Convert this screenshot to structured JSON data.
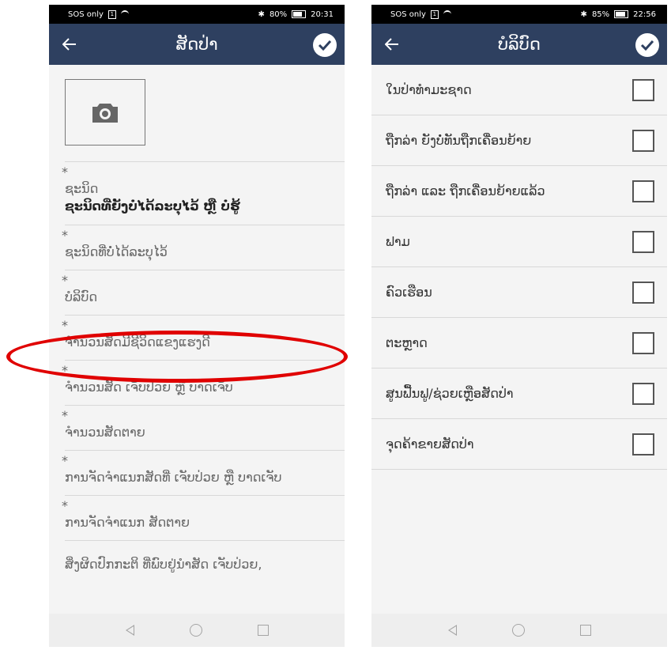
{
  "left": {
    "status": {
      "carrier": "SOS only",
      "battery": "80%",
      "time": "20:31"
    },
    "title": "ສັດປ່າ",
    "fields": [
      {
        "label": "ຊະນິດ",
        "value": "ຊະນິດທີ່ຍັງບໍ່ໄດ້ລະບຸໄວ້ ຫຼື ບໍ່ຮູ້",
        "required": "*"
      },
      {
        "label": "ຊະນິດທີ່ບໍ່ໄດ້ລະບຸໄວ້",
        "required": "*"
      },
      {
        "label": "ບໍລິບົດ",
        "required": "*"
      },
      {
        "label": "ຈຳນວນສັດມີຊີວິດແຂງແຮງດີ",
        "required": "*"
      },
      {
        "label": "ຈຳນວນສັດ ເຈັບປ່ວຍ ຫຼື ບາດເຈັບ",
        "required": "*"
      },
      {
        "label": "ຈຳນວນສັດຕາຍ",
        "required": "*"
      },
      {
        "label": "ການຈັດຈຳແນກສັດທີ່ ເຈັບປ່ວຍ ຫຼື ບາດເຈັບ",
        "required": "*"
      },
      {
        "label": "ການຈັດຈຳແນກ ສັດຕາຍ",
        "required": "*"
      },
      {
        "label": "ສິ່ງຜິດປົກກະຕິ ທີ່ພົບຢູ່ນຳສັດ ເຈັບປ່ວຍ,"
      }
    ]
  },
  "right": {
    "status": {
      "carrier": "SOS only",
      "battery": "85%",
      "time": "22:56"
    },
    "title": "ບໍລິບົດ",
    "items": [
      "ໃນປ່າທຳມະຊາດ",
      "ຖືກລ່າ ຍັງບໍ່ທັນຖືກເຄື່ອນຍ້າຍ",
      "ຖືກລ່າ ແລະ ຖືກເຄື່ອນຍ້າຍແລ້ວ",
      "ຟາມ",
      "ຄົວເຮືອນ",
      "ຕະຫຼາດ",
      "ສູນຟື້ນຟູ/ຊ່ວຍເຫຼືອສັດປ່າ",
      "ຈຸດຄ້າຂາຍສັດປ່າ"
    ]
  },
  "colors": {
    "appbar": "#2e4060",
    "highlight": "#e00000"
  },
  "icons": {
    "back": "arrow-left-icon",
    "done": "check-circle-icon",
    "photo": "camera-icon"
  }
}
